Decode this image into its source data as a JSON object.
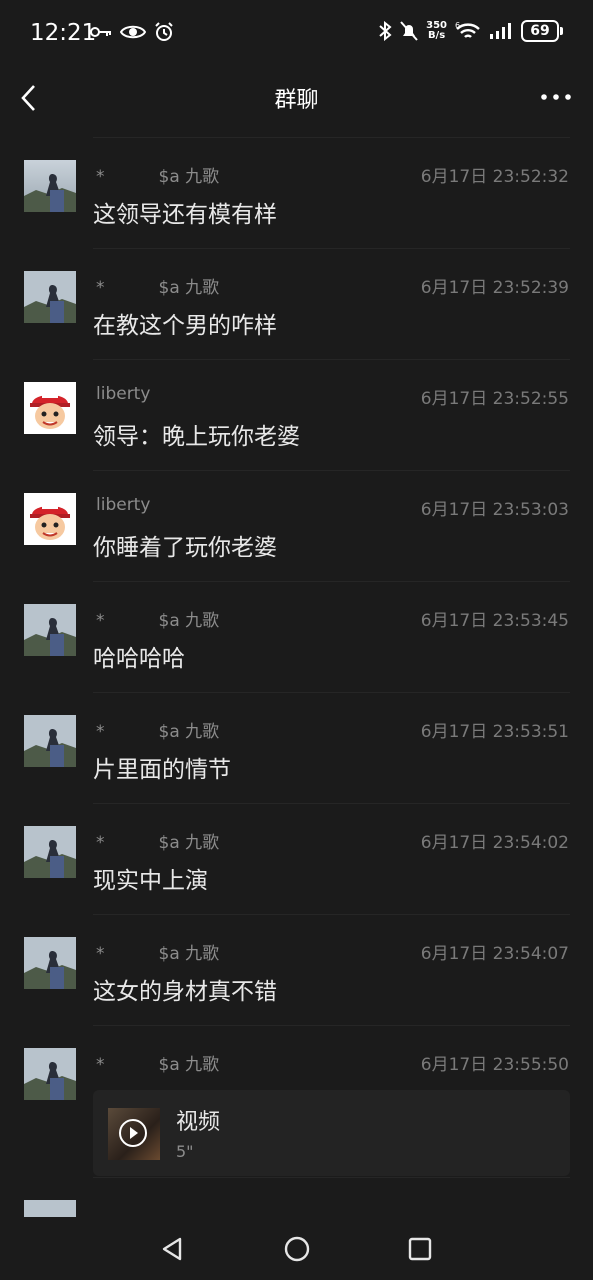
{
  "status": {
    "time": "12:21",
    "net_speed_top": "350",
    "net_speed_bottom": "B/s",
    "battery": "69"
  },
  "header": {
    "title": "群聊"
  },
  "messages": [
    {
      "sender_prefix": "*",
      "sender": "$a 九歌",
      "time": "6月17日 23:52:32",
      "text": "这领导还有模有样",
      "avatar": "landscape"
    },
    {
      "sender_prefix": "*",
      "sender": "$a 九歌",
      "time": "6月17日 23:52:39",
      "text": "在教这个男的咋样",
      "avatar": "landscape"
    },
    {
      "sender_prefix": "",
      "sender": "liberty",
      "time": "6月17日 23:52:55",
      "text": "领导：晚上玩你老婆",
      "avatar": "cartoon"
    },
    {
      "sender_prefix": "",
      "sender": "liberty",
      "time": "6月17日 23:53:03",
      "text": "你睡着了玩你老婆",
      "avatar": "cartoon"
    },
    {
      "sender_prefix": "*",
      "sender": "$a 九歌",
      "time": "6月17日 23:53:45",
      "text": "哈哈哈哈",
      "avatar": "landscape"
    },
    {
      "sender_prefix": "*",
      "sender": "$a 九歌",
      "time": "6月17日 23:53:51",
      "text": "片里面的情节",
      "avatar": "landscape"
    },
    {
      "sender_prefix": "*",
      "sender": "$a 九歌",
      "time": "6月17日 23:54:02",
      "text": "现实中上演",
      "avatar": "landscape"
    },
    {
      "sender_prefix": "*",
      "sender": "$a 九歌",
      "time": "6月17日 23:54:07",
      "text": "这女的身材真不错",
      "avatar": "landscape"
    },
    {
      "sender_prefix": "*",
      "sender": "$a 九歌",
      "time": "6月17日 23:55:50",
      "text": "",
      "avatar": "landscape",
      "video": {
        "title": "视频",
        "duration": "5\""
      }
    }
  ],
  "colors": {
    "background": "#1b1b1b",
    "text": "#e8e8e8",
    "muted": "#8c8c8c"
  },
  "icons": {
    "back": "chevron-left-icon",
    "more": "more-dots-icon",
    "nav_back": "triangle-back-icon",
    "nav_home": "circle-home-icon",
    "nav_recents": "square-recents-icon"
  }
}
